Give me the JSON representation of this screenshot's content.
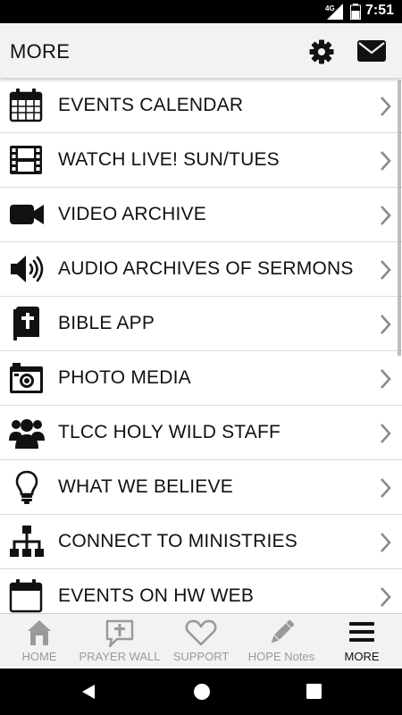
{
  "status_bar": {
    "time": "7:51",
    "network": "4G"
  },
  "header": {
    "title": "MORE",
    "settings_icon": "gear-icon",
    "mail_icon": "envelope-icon"
  },
  "menu_items": [
    {
      "label": "EVENTS CALENDAR",
      "icon": "calendar-icon"
    },
    {
      "label": "WATCH LIVE! SUN/TUES",
      "icon": "film-icon"
    },
    {
      "label": "VIDEO ARCHIVE",
      "icon": "video-camera-icon"
    },
    {
      "label": "AUDIO ARCHIVES OF SERMONS",
      "icon": "speaker-icon"
    },
    {
      "label": "BIBLE APP",
      "icon": "bible-icon"
    },
    {
      "label": "PHOTO MEDIA",
      "icon": "camera-icon"
    },
    {
      "label": "TLCC HOLY WILD STAFF",
      "icon": "users-icon"
    },
    {
      "label": "WHAT WE BELIEVE",
      "icon": "lightbulb-icon"
    },
    {
      "label": "CONNECT TO MINISTRIES",
      "icon": "sitemap-icon"
    },
    {
      "label": "EVENTS ON HW WEB",
      "icon": "calendar-blank-icon"
    }
  ],
  "bottom_nav": [
    {
      "label": "HOME",
      "icon": "home-icon",
      "active": false
    },
    {
      "label": "PRAYER WALL",
      "icon": "prayer-bubble-icon",
      "active": false
    },
    {
      "label": "SUPPORT",
      "icon": "heart-icon",
      "active": false
    },
    {
      "label": "HOPE Notes",
      "icon": "pencil-icon",
      "active": false
    },
    {
      "label": "MORE",
      "icon": "hamburger-icon",
      "active": true
    }
  ],
  "colors": {
    "header_bg": "#f2f2f2",
    "inactive_nav": "#9a9a9a",
    "active_nav": "#111111",
    "chevron": "#8a8a8a"
  }
}
